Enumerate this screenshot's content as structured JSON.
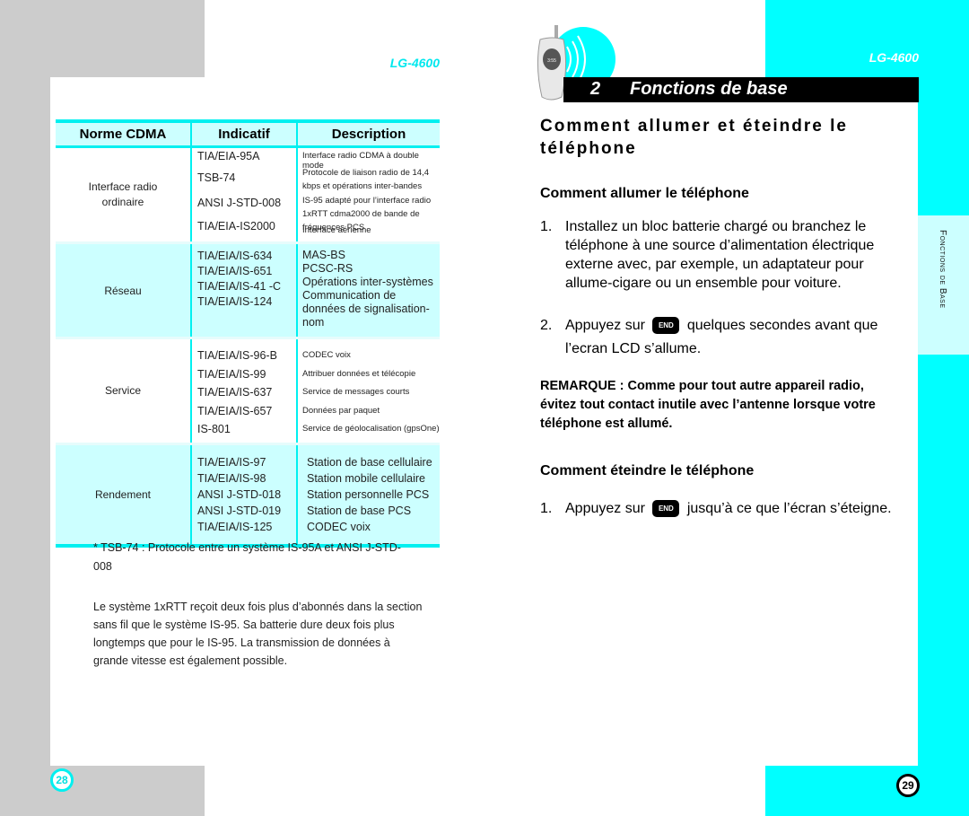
{
  "left_page": {
    "model": "LG-4600",
    "page_number": "28",
    "table": {
      "headers": [
        "Norme CDMA",
        "Indicatif",
        "Description"
      ],
      "groups": [
        {
          "norme": "Interface radio ordinaire",
          "rows": [
            {
              "indicatif": "TIA/EIA-95A",
              "description": "Interface radio CDMA à double mode"
            },
            {
              "indicatif": "TSB-74",
              "description": "Protocole de liaison radio de 14,4 kbps et opérations inter-bandes"
            },
            {
              "indicatif": "ANSI J-STD-008",
              "description": "IS-95 adapté pour l’interface radio 1xRTT cdma2000 de bande de fréquences PCS"
            },
            {
              "indicatif": "TIA/EIA-IS2000",
              "description": "Interface aérienne"
            }
          ]
        },
        {
          "norme": "Réseau",
          "rows": [
            {
              "indicatif": "TIA/EIA/IS-634",
              "description": "MAS-BS"
            },
            {
              "indicatif": "TIA/EIA/IS-651",
              "description": "PCSC-RS"
            },
            {
              "indicatif": "TIA/EIA/IS-41 -C",
              "description": "Opérations inter-systèmes"
            },
            {
              "indicatif": "TIA/EIA/IS-124",
              "description": "Communication de données de signalisation-nom"
            }
          ]
        },
        {
          "norme": "Service",
          "rows": [
            {
              "indicatif": "TIA/EIA/IS-96-B",
              "description": "CODEC voix"
            },
            {
              "indicatif": "TIA/EIA/IS-99",
              "description": "Attribuer données et télécopie"
            },
            {
              "indicatif": "TIA/EIA/IS-637",
              "description": "Service de messages courts"
            },
            {
              "indicatif": "TIA/EIA/IS-657",
              "description": "Données par paquet"
            },
            {
              "indicatif": "IS-801",
              "description": "Service de géolocalisation (gpsOne)"
            }
          ]
        },
        {
          "norme": "Rendement",
          "rows": [
            {
              "indicatif": "TIA/EIA/IS-97",
              "description": "Station de base cellulaire"
            },
            {
              "indicatif": "TIA/EIA/IS-98",
              "description": "Station mobile cellulaire"
            },
            {
              "indicatif": "ANSI J-STD-018",
              "description": "Station personnelle PCS"
            },
            {
              "indicatif": "ANSI J-STD-019",
              "description": "Station de base PCS"
            },
            {
              "indicatif": "TIA/EIA/IS-125",
              "description": "CODEC voix"
            }
          ]
        }
      ]
    },
    "footnote": "* TSB-74 : Protocole entre un système IS-95A et ANSI J-STD-008",
    "paragraph": "Le système 1xRTT reçoit deux fois plus d’abonnés dans la section sans fil que le système IS-95. Sa batterie dure deux fois plus longtemps que pour le IS-95. La transmission de données à grande vitesse est également possible."
  },
  "right_page": {
    "model": "LG-4600",
    "chapter_number": "2",
    "chapter_title": "Fonctions de base",
    "side_tab": "Fonctions de Base",
    "page_number": "29",
    "heading": "Comment allumer et éteindre le téléphone",
    "section_on": {
      "title": "Comment allumer le téléphone",
      "steps": [
        {
          "num": "1.",
          "text": "Installez un bloc batterie chargé ou branchez le téléphone à une source d’alimentation électrique externe avec, par exemple, un adaptateur pour allume-cigare ou un ensemble pour voiture."
        },
        {
          "num": "2.",
          "before": "Appuyez sur",
          "key": "END",
          "after": "quelques secondes avant que l’ecran LCD s’allume."
        }
      ]
    },
    "remarque": "REMARQUE : Comme pour tout autre appareil radio, évitez tout contact inutile avec l’antenne lorsque votre téléphone est allumé.",
    "section_off": {
      "title": "Comment éteindre le téléphone",
      "steps": [
        {
          "num": "1.",
          "before": "Appuyez sur",
          "key": "END",
          "after": "jusqu’à ce que l’écran s’éteigne."
        }
      ]
    },
    "colors": {
      "accent": "#00ffff",
      "accent_light": "#ccffff",
      "title_bar": "#000000"
    }
  }
}
